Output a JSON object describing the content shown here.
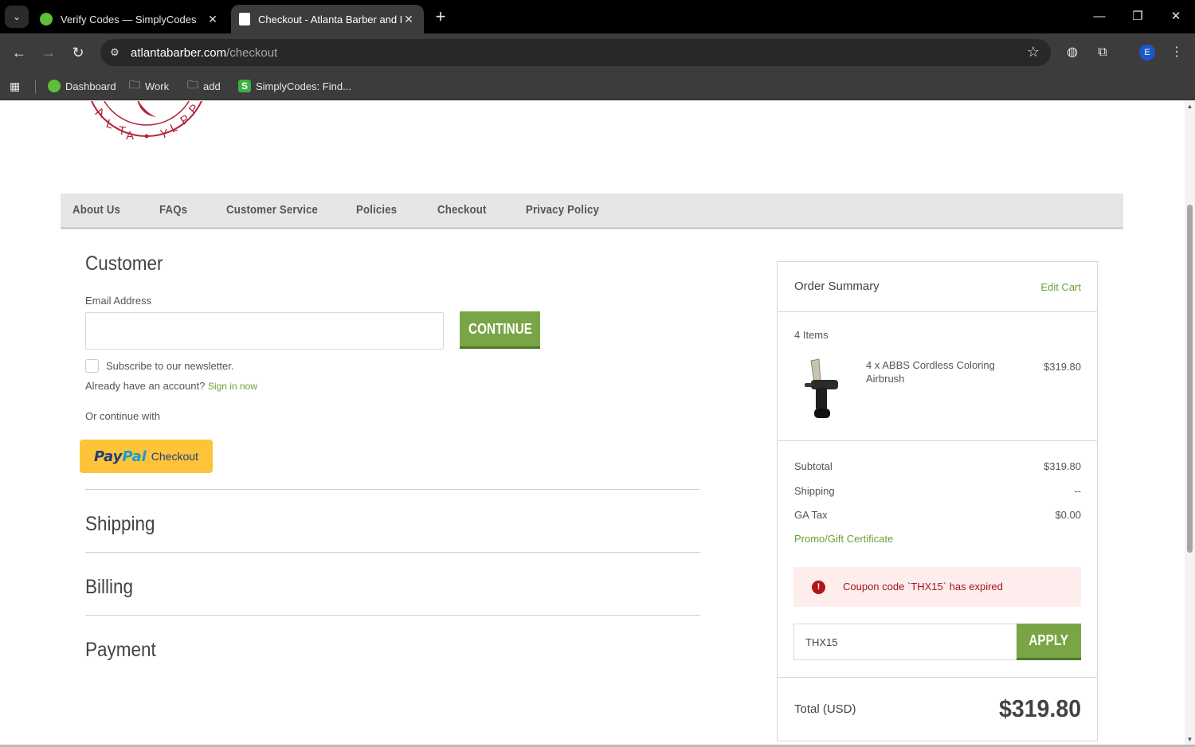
{
  "browser": {
    "tabs": [
      {
        "title": "Verify Codes — SimplyCodes",
        "active": false,
        "favicon_color": "#5fbf38"
      },
      {
        "title": "Checkout - Atlanta Barber and Beauty Supply",
        "active": true,
        "favicon_color": "#ffffff"
      }
    ],
    "new_tab_icon": "plus-icon",
    "url_domain": "atlantabarber.com",
    "url_path": "/checkout",
    "profile_initial": "E",
    "bookmarks": [
      {
        "label": "Dashboard",
        "icon": "simplycodes-icon"
      },
      {
        "label": "Work",
        "icon": "folder-icon"
      },
      {
        "label": "add",
        "icon": "folder-icon"
      },
      {
        "label": "SimplyCodes: Find...",
        "icon": "simplycodes-s-icon"
      }
    ]
  },
  "nav": {
    "items": [
      "About Us",
      "FAQs",
      "Customer Service",
      "Policies",
      "Checkout",
      "Privacy Policy"
    ]
  },
  "customer": {
    "title": "Customer",
    "email_label": "Email Address",
    "email_value": "",
    "continue_label": "CONTINUE",
    "newsletter_label": "Subscribe to our newsletter.",
    "account_prompt": "Already have an account?",
    "sign_in_label": "Sign in now",
    "or_continue": "Or continue with",
    "paypal_pay": "Pay",
    "paypal_pal": "Pal",
    "paypal_checkout": "Checkout"
  },
  "sections": {
    "shipping": "Shipping",
    "billing": "Billing",
    "payment": "Payment"
  },
  "summary": {
    "title": "Order Summary",
    "edit_cart": "Edit Cart",
    "items_count": "4 Items",
    "product": {
      "name": "4 x ABBS Cordless Coloring Airbrush",
      "price": "$319.80"
    },
    "subtotal_label": "Subtotal",
    "subtotal_value": "$319.80",
    "shipping_label": "Shipping",
    "shipping_value": "--",
    "tax_label": "GA Tax",
    "tax_value": "$0.00",
    "promo_label": "Promo/Gift Certificate",
    "alert_text": "Coupon code `THX15` has expired",
    "coupon_value": "THX15",
    "apply_label": "APPLY",
    "total_label": "Total (USD)",
    "total_value": "$319.80"
  },
  "colors": {
    "accent_green": "#7aa546",
    "link_green": "#6b9f3a",
    "alert_red": "#a3151a",
    "logo_red": "#b0243a"
  }
}
